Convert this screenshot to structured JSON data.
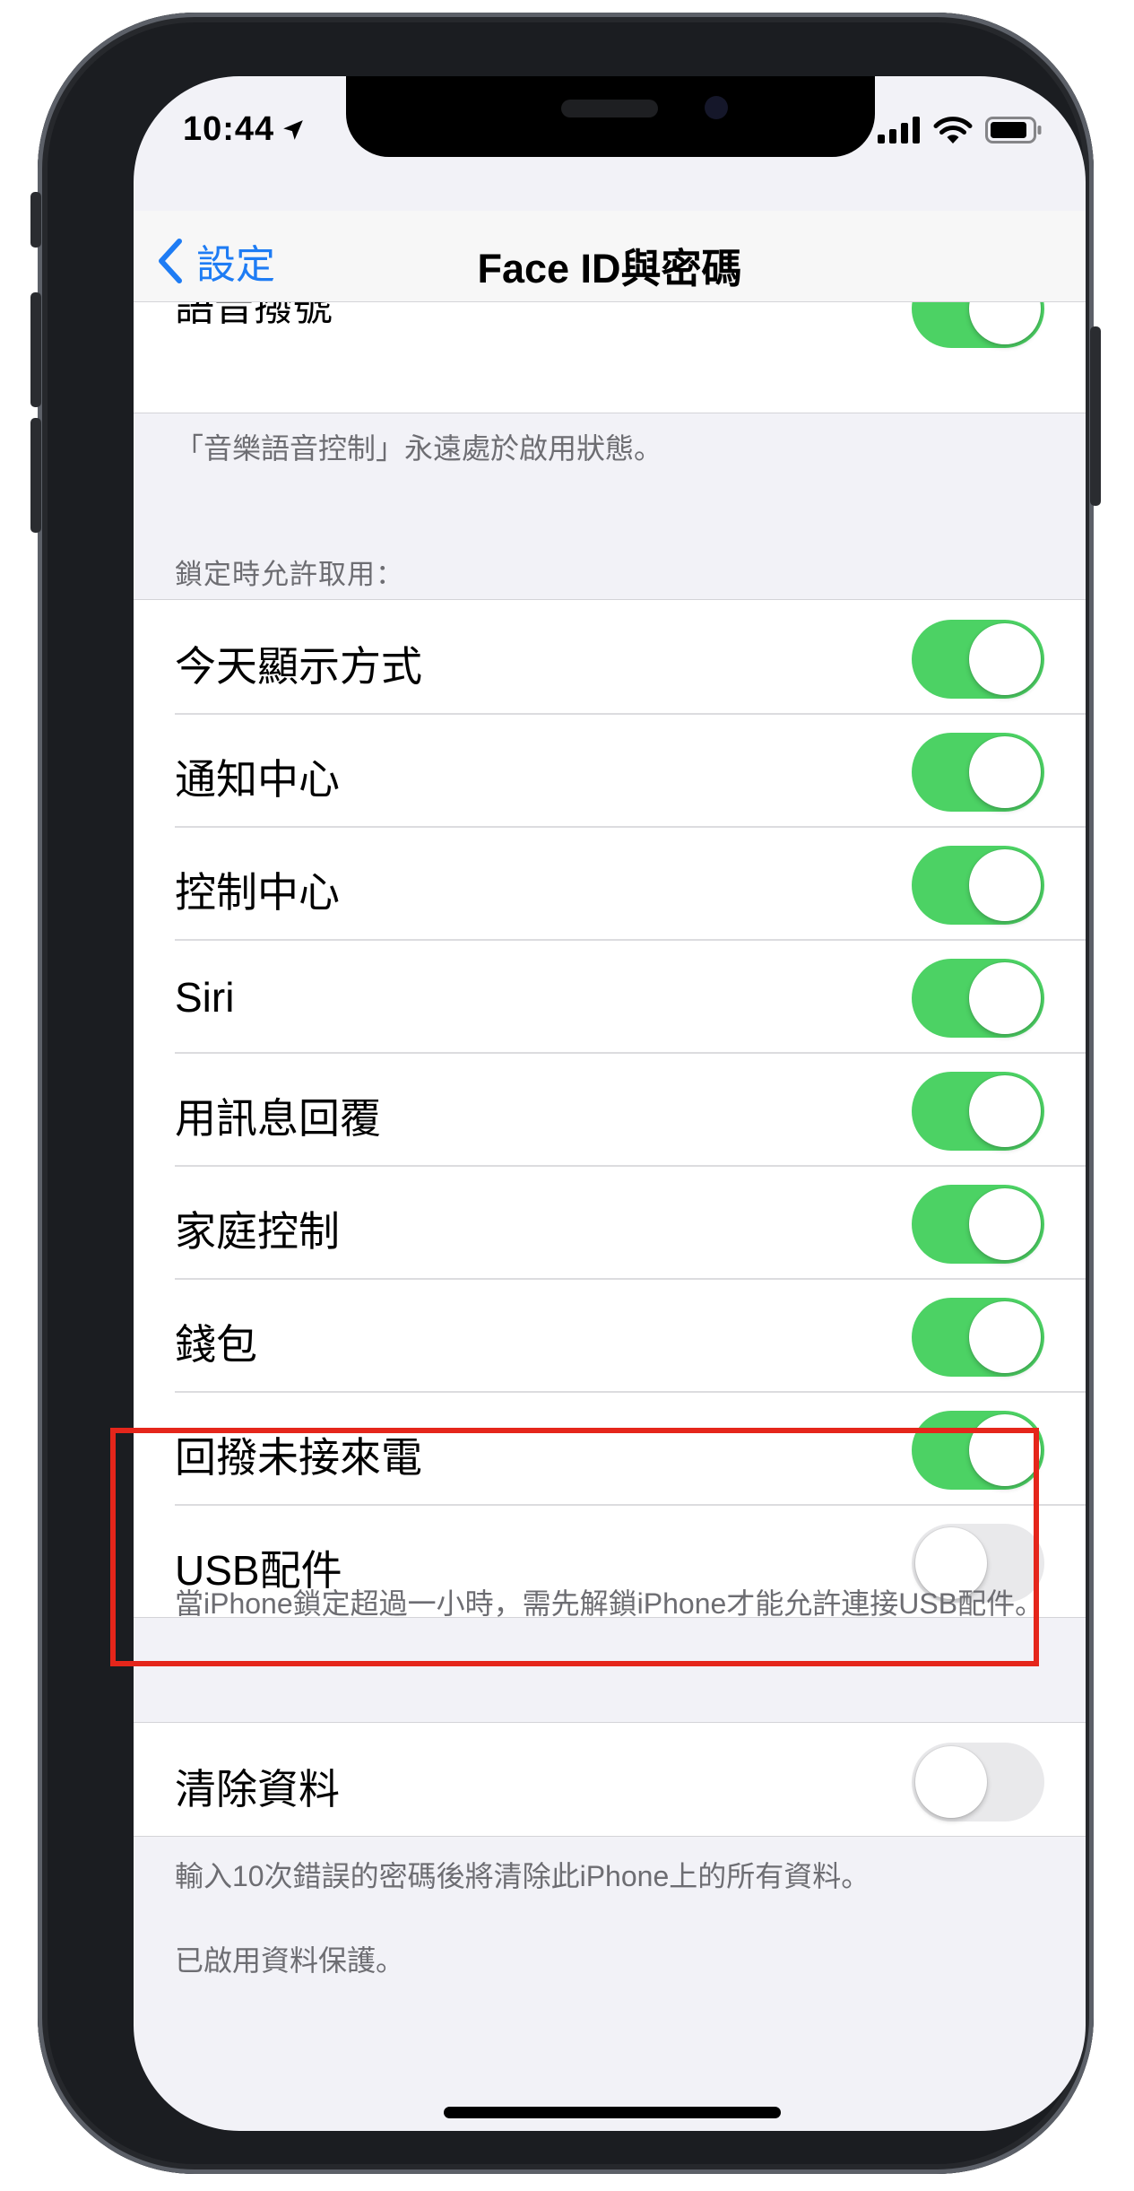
{
  "status_bar": {
    "time": "10:44",
    "icons": [
      "location-arrow-icon",
      "cellular-signal-icon",
      "wifi-icon",
      "battery-icon"
    ]
  },
  "nav": {
    "back_label": "設定",
    "title": "Face ID與密碼"
  },
  "partial_row": {
    "label": "語音撥號",
    "toggle_on": true
  },
  "partial_footer": "「音樂語音控制」永遠處於啟用狀態。",
  "lock_section": {
    "header": "鎖定時允許取用：",
    "items": [
      {
        "label": "今天顯示方式",
        "on": true
      },
      {
        "label": "通知中心",
        "on": true
      },
      {
        "label": "控制中心",
        "on": true
      },
      {
        "label": "Siri",
        "on": true
      },
      {
        "label": "用訊息回覆",
        "on": true
      },
      {
        "label": "家庭控制",
        "on": true
      },
      {
        "label": "錢包",
        "on": true
      },
      {
        "label": "回撥未接來電",
        "on": true
      },
      {
        "label": "USB配件",
        "on": false
      }
    ],
    "footer": "當iPhone鎖定超過一小時，需先解鎖iPhone才能允許連接USB配件。"
  },
  "erase_section": {
    "label": "清除資料",
    "on": false,
    "footer_1": "輸入10次錯誤的密碼後將清除此iPhone上的所有資料。",
    "footer_2": "已啟用資料保護。"
  },
  "colors": {
    "accent": "#1E7CF4",
    "toggle_on": "#4CD264",
    "toggle_off": "#E9E9EB",
    "highlight": "#E5261B",
    "background": "#F2F2F7",
    "secondary_text": "#6D6D72"
  }
}
